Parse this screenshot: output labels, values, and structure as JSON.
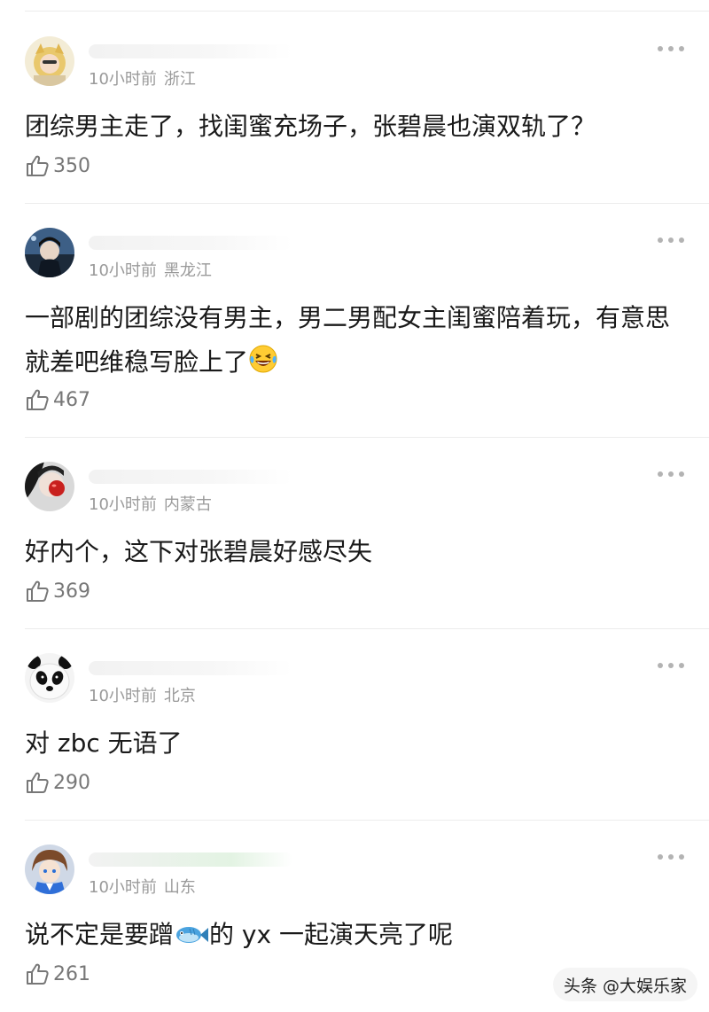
{
  "comments": [
    {
      "time": "10小时前",
      "location": "浙江",
      "text": "团综男主走了，找闺蜜充场子，张碧晨也演双轨了？",
      "likes": "350"
    },
    {
      "time": "10小时前",
      "location": "黑龙江",
      "text": "一部剧的团综没有男主，男二男配女主闺蜜陪着玩，有意思就差吧维稳写脸上了",
      "emoji": "laughing-tears",
      "likes": "467"
    },
    {
      "time": "10小时前",
      "location": "内蒙古",
      "text": "好内个，这下对张碧晨好感尽失",
      "likes": "369"
    },
    {
      "time": "10小时前",
      "location": "北京",
      "text": "对 zbc 无语了",
      "likes": "290"
    },
    {
      "time": "10小时前",
      "location": "山东",
      "text_before": "说不定是要蹭",
      "emoji": "fish",
      "text_after": "的 yx 一起演天亮了呢",
      "likes": "261"
    }
  ],
  "watermark": "头条 @大娱乐家",
  "icons": {
    "like": "thumbs-up-icon",
    "more": "more-dots-icon"
  },
  "colors": {
    "text": "#1a1a1a",
    "meta": "#9a9a9a",
    "divider": "#ececec"
  }
}
